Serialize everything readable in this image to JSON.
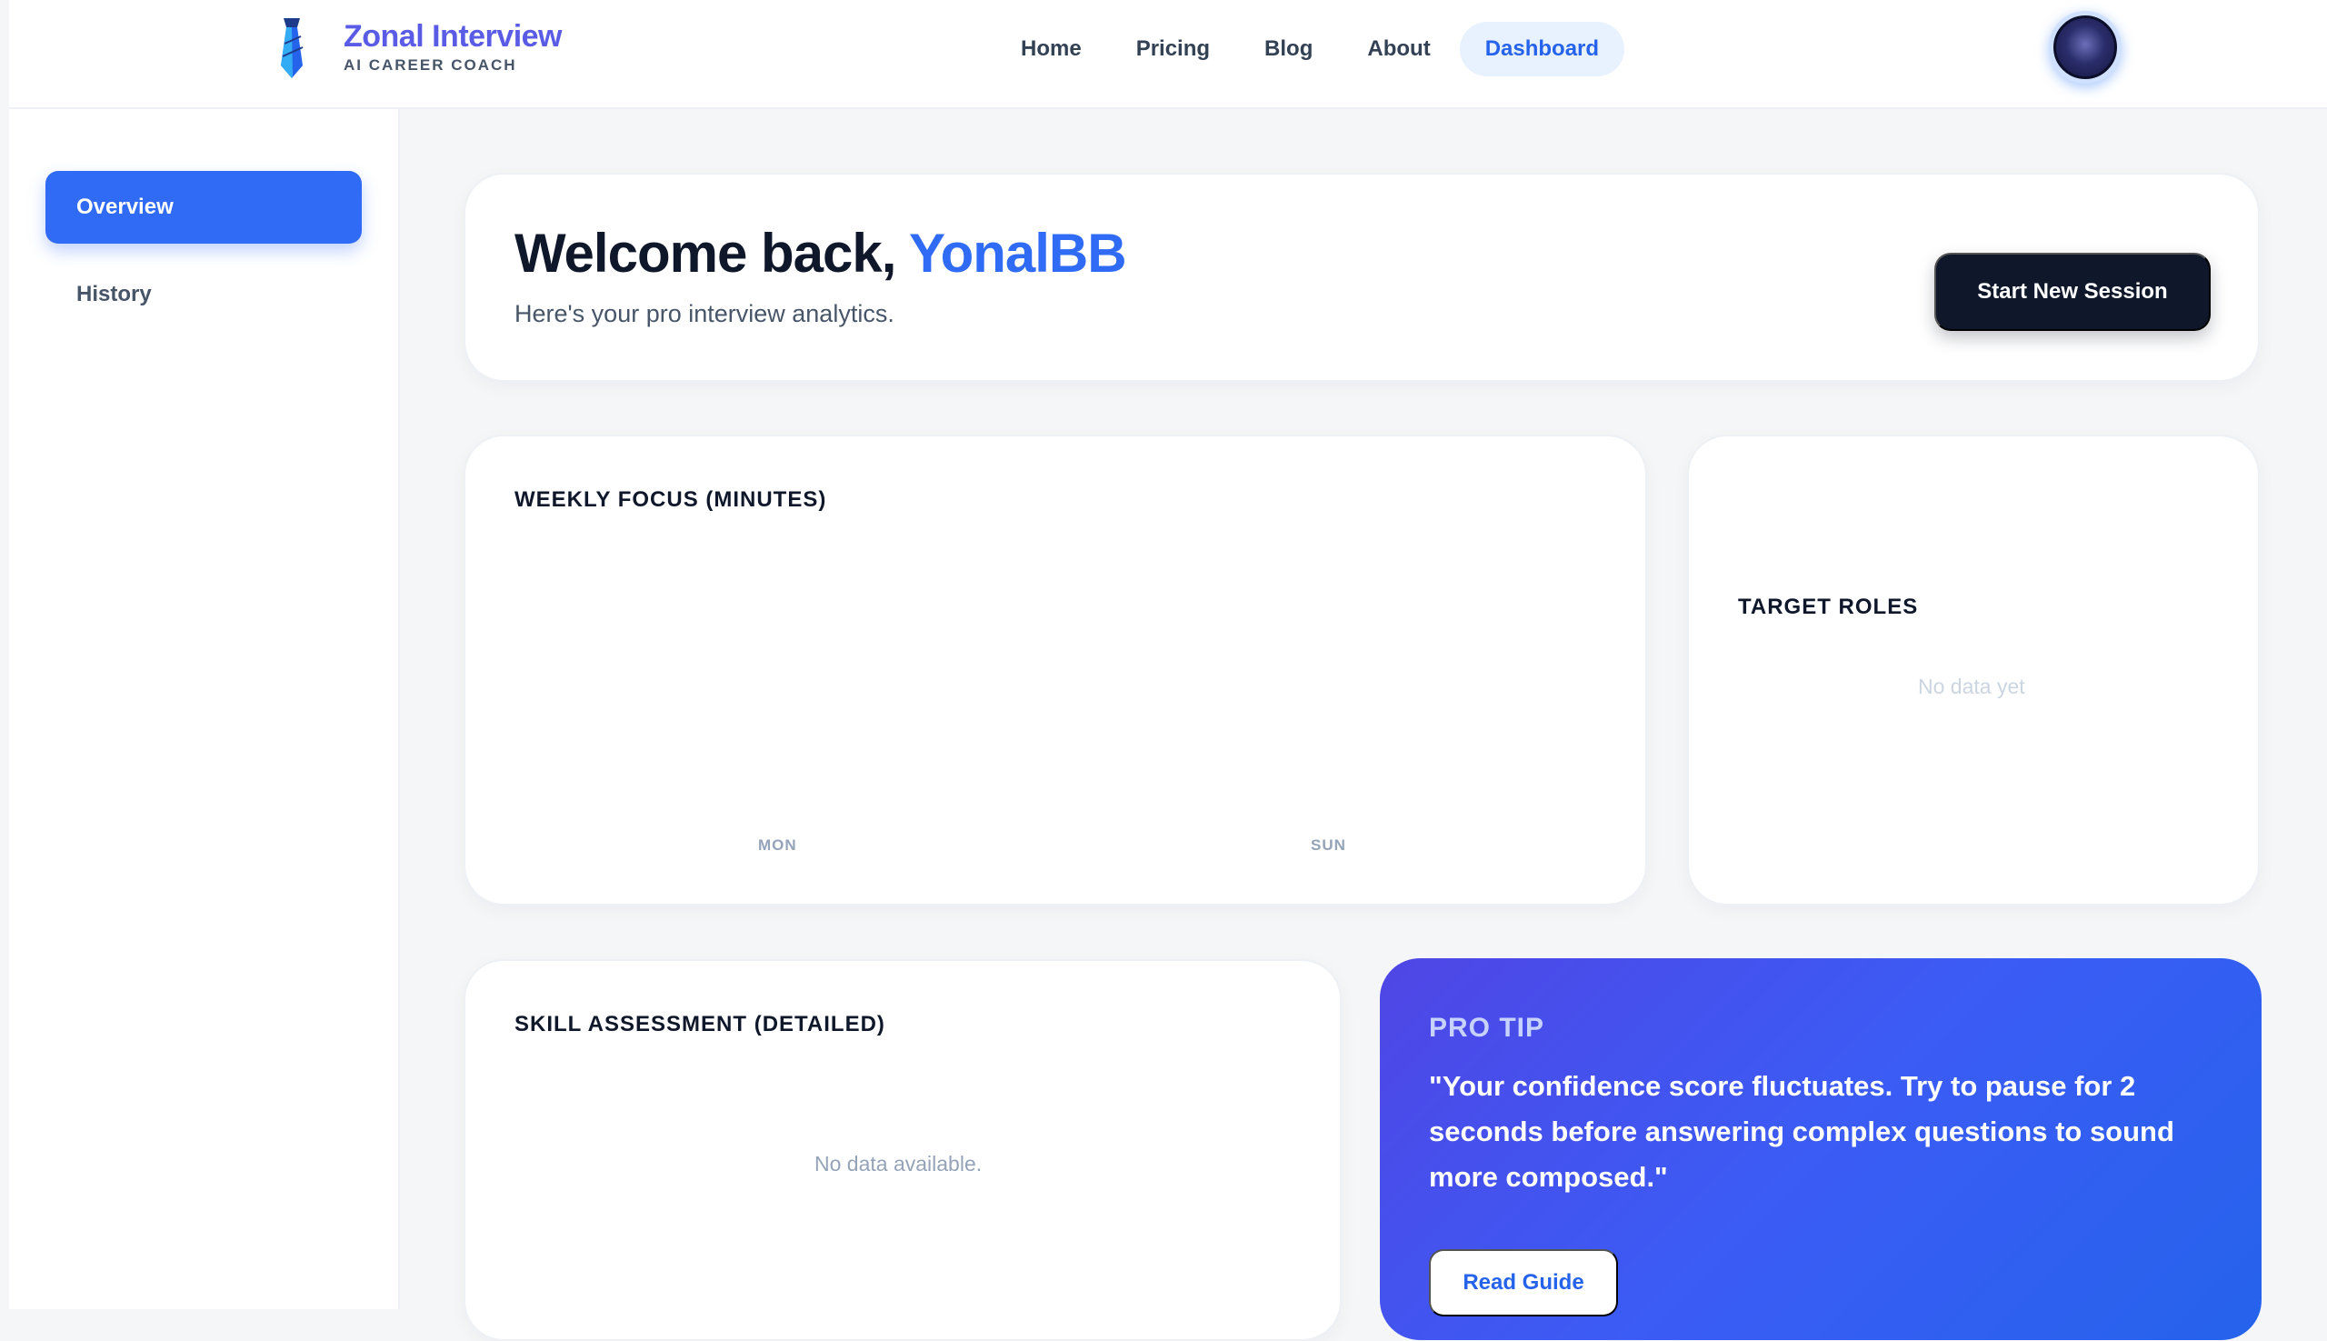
{
  "brand": {
    "name": "Zonal Interview",
    "tagline": "AI CAREER COACH"
  },
  "nav": {
    "items": [
      {
        "label": "Home"
      },
      {
        "label": "Pricing"
      },
      {
        "label": "Blog"
      },
      {
        "label": "About"
      },
      {
        "label": "Dashboard",
        "active": true
      }
    ]
  },
  "sidebar": {
    "items": [
      {
        "label": "Overview",
        "active": true
      },
      {
        "label": "History"
      }
    ]
  },
  "welcome": {
    "greeting": "Welcome back,",
    "username": "YonalBB",
    "subtitle": "Here's your pro interview analytics.",
    "cta_label": "Start New Session"
  },
  "weekly_focus": {
    "title": "WEEKLY FOCUS (MINUTES)",
    "tick_start": "MON",
    "tick_end": "SUN"
  },
  "target_roles": {
    "title": "TARGET ROLES",
    "empty_text": "No data yet"
  },
  "skill_assessment": {
    "title": "SKILL ASSESSMENT (DETAILED)",
    "empty_text": "No data available."
  },
  "pro_tip": {
    "title": "PRO TIP",
    "text": "\"Your confidence score fluctuates. Try to pause for 2 seconds before answering complex questions to sound more composed.\"",
    "button_label": "Read Guide"
  },
  "colors": {
    "accent": "#2f6bf5",
    "brand": "#5b5ce6",
    "dark_button": "#0f172a"
  }
}
